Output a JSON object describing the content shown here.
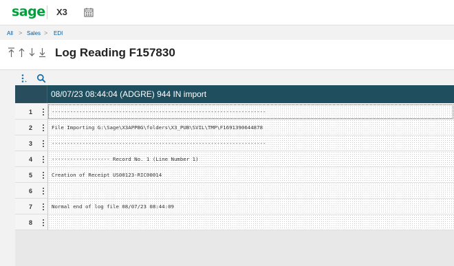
{
  "app": {
    "brand": "sage",
    "product": "X3",
    "calendar_icon": "calendar-icon"
  },
  "breadcrumb": {
    "items": [
      "All",
      "Sales",
      "EDI"
    ],
    "separator": ">"
  },
  "page": {
    "title": "Log Reading F157830"
  },
  "nav_icons": [
    "first-record-icon",
    "previous-record-icon",
    "next-record-icon",
    "last-record-icon"
  ],
  "grid_toolbar": {
    "icons": [
      "more-vertical-icon",
      "search-icon"
    ]
  },
  "grid": {
    "header": "08/07/23 08:44:04 (ADGRE) 944 IN import",
    "rows": [
      {
        "num": "1",
        "text": "----------------------------------------------------------------------"
      },
      {
        "num": "2",
        "text": "File Importing G:\\Sage\\X3APPBG\\folders\\X3_PUB\\SVIL\\TMP\\F1691390644878"
      },
      {
        "num": "3",
        "text": "----------------------------------------------------------------------"
      },
      {
        "num": "4",
        "text": "------------------- Record No. 1 (Line Number 1)"
      },
      {
        "num": "5",
        "text": "Creation of Receipt US00123-RIC00014"
      },
      {
        "num": "6",
        "text": ""
      },
      {
        "num": "7",
        "text": "Normal end of log file 08/07/23 08:44:09"
      },
      {
        "num": "8",
        "text": ""
      }
    ]
  },
  "colors": {
    "brand_green": "#00a13b",
    "grid_header": "#1f4e5f",
    "link_blue": "#005a9e"
  }
}
